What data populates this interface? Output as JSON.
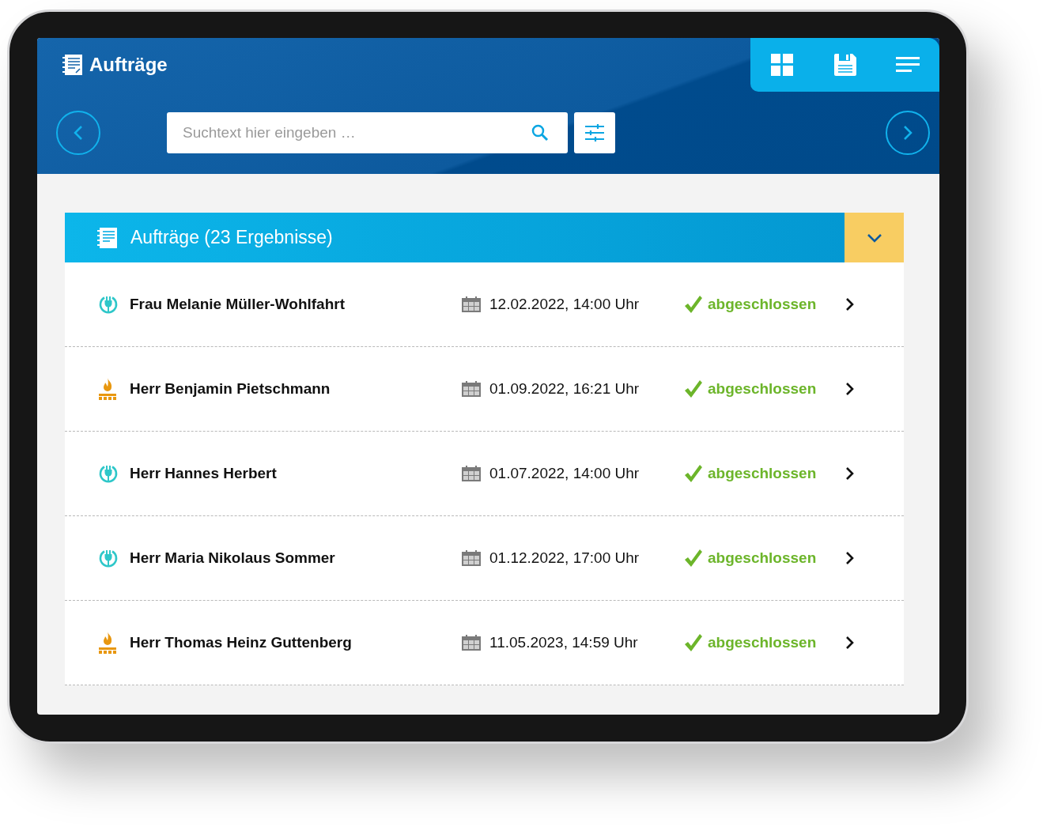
{
  "header": {
    "title": "Aufträge",
    "search": {
      "placeholder": "Suchtext hier eingeben …"
    }
  },
  "panel": {
    "title": "Aufträge (23 Ergebnisse)",
    "expanded": true
  },
  "orders": [
    {
      "kind": "plug",
      "name": "Frau Melanie Müller-Wohlfahrt",
      "date": "12.02.2022, 14:00 Uhr",
      "status": "abgeschlossen"
    },
    {
      "kind": "fire",
      "name": "Herr Benjamin Pietschmann",
      "date": "01.09.2022, 16:21 Uhr",
      "status": "abgeschlossen"
    },
    {
      "kind": "plug",
      "name": "Herr Hannes Herbert",
      "date": "01.07.2022, 14:00 Uhr",
      "status": "abgeschlossen"
    },
    {
      "kind": "plug",
      "name": "Herr Maria Nikolaus Sommer",
      "date": "01.12.2022, 17:00 Uhr",
      "status": "abgeschlossen"
    },
    {
      "kind": "fire",
      "name": "Herr Thomas Heinz Guttenberg",
      "date": "11.05.2023, 14:59 Uhr",
      "status": "abgeschlossen"
    }
  ]
}
